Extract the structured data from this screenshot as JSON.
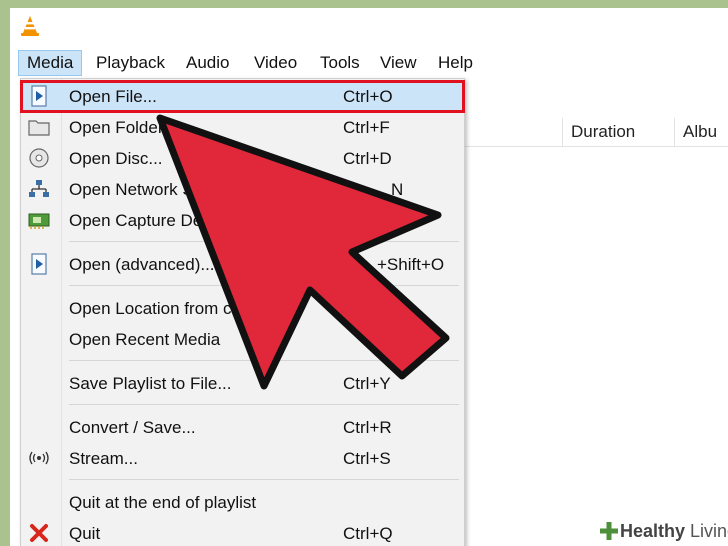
{
  "menubar": {
    "items": [
      "Media",
      "Playback",
      "Audio",
      "Video",
      "Tools",
      "View",
      "Help"
    ],
    "active": "Media"
  },
  "playlist": {
    "columns": [
      "Duration",
      "Albu"
    ]
  },
  "media_menu": {
    "items": [
      {
        "label": "Open File...",
        "shortcut": "Ctrl+O",
        "icon": "play-file-icon",
        "highlighted": true
      },
      {
        "label": "Open Folder...",
        "shortcut": "Ctrl+F",
        "icon": "folder-icon"
      },
      {
        "label": "Open Disc...",
        "shortcut": "Ctrl+D",
        "icon": "disc-icon"
      },
      {
        "label": "Open Network S",
        "shortcut": "N",
        "icon": "network-icon"
      },
      {
        "label": "Open Capture De",
        "shortcut": "",
        "icon": "capture-card-icon"
      },
      {
        "label": "Open (advanced)...",
        "shortcut": "+Shift+O",
        "icon": "play-file-icon"
      },
      {
        "label": "Open Location from cl",
        "shortcut": "",
        "icon": ""
      },
      {
        "label": "Open Recent Media",
        "shortcut": "",
        "icon": ""
      },
      {
        "label": "Save Playlist to File...",
        "shortcut": "Ctrl+Y",
        "icon": ""
      },
      {
        "label": "Convert / Save...",
        "shortcut": "Ctrl+R",
        "icon": ""
      },
      {
        "label": "Stream...",
        "shortcut": "Ctrl+S",
        "icon": "stream-icon"
      },
      {
        "label": "Quit at the end of playlist",
        "shortcut": "",
        "icon": ""
      },
      {
        "label": "Quit",
        "shortcut": "Ctrl+Q",
        "icon": "quit-icon"
      }
    ]
  },
  "watermark": {
    "brand_bold": "Healthy",
    "brand_rest": " Living"
  },
  "colors": {
    "highlight": "#cce4f7",
    "highlight_border": "#e0121f",
    "arrow_fill": "#e0283a",
    "background": "#a9c28e"
  }
}
